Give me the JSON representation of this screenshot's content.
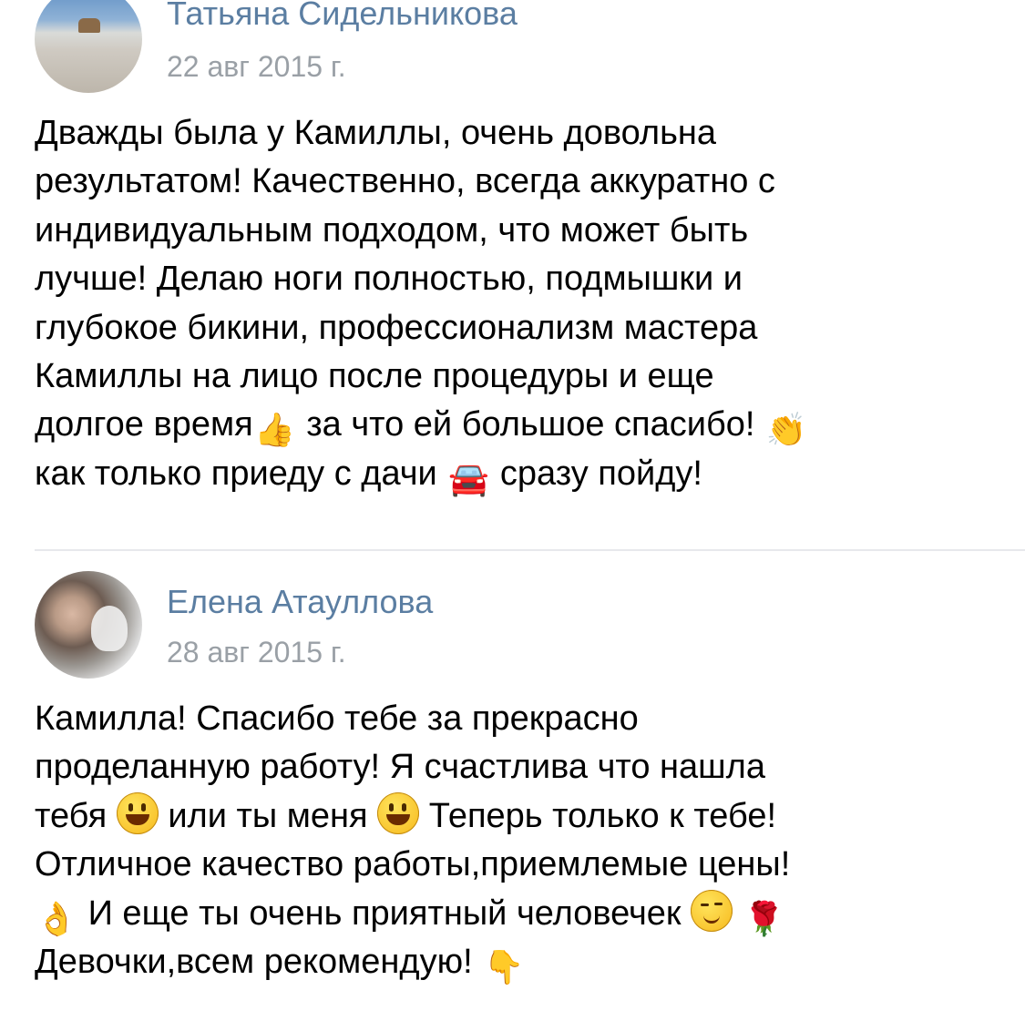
{
  "comments": [
    {
      "author": "Татьяна Сидельникова",
      "date": "22 авг 2015 г.",
      "lines": [
        [
          "Дважды была у Камиллы, очень довольна"
        ],
        [
          "результатом! Качественно, всегда аккуратно с"
        ],
        [
          "индивидуальным подходом, что может быть"
        ],
        [
          "лучше! Делаю ноги полностью, подмышки и"
        ],
        [
          "глубокое бикини, профессионализм мастера"
        ],
        [
          "Камиллы на лицо после процедуры и еще"
        ],
        [
          "долгое время",
          " за что ей большое спасибо!"
        ],
        [
          "как только приеду с дачи",
          " сразу пойду!"
        ]
      ],
      "emojis": {
        "thumbs_up": "👍",
        "clapping": "👏",
        "car": "🚘"
      }
    },
    {
      "author": "Елена Атауллова",
      "date": "28 авг 2015 г.",
      "lines": [
        [
          "Камилла! Спасибо тебе за прекрасно"
        ],
        [
          "проделанную работу! Я счастлива что нашла"
        ],
        [
          "тебя",
          "или ты меня",
          "Теперь только к тебе!"
        ],
        [
          "Отличное качество работы,приемлемые цены!"
        ],
        [
          "И еще ты очень приятный человечек"
        ],
        [
          "Девочки,всем рекомендую!"
        ]
      ],
      "emojis": {
        "ok_hand": "👌",
        "rose": "🌹",
        "pointing_down": "👇"
      }
    }
  ],
  "colors": {
    "author": "#5b7ea2",
    "date": "#9aa0a6",
    "text": "#000000",
    "divider": "#e7e8ec"
  }
}
